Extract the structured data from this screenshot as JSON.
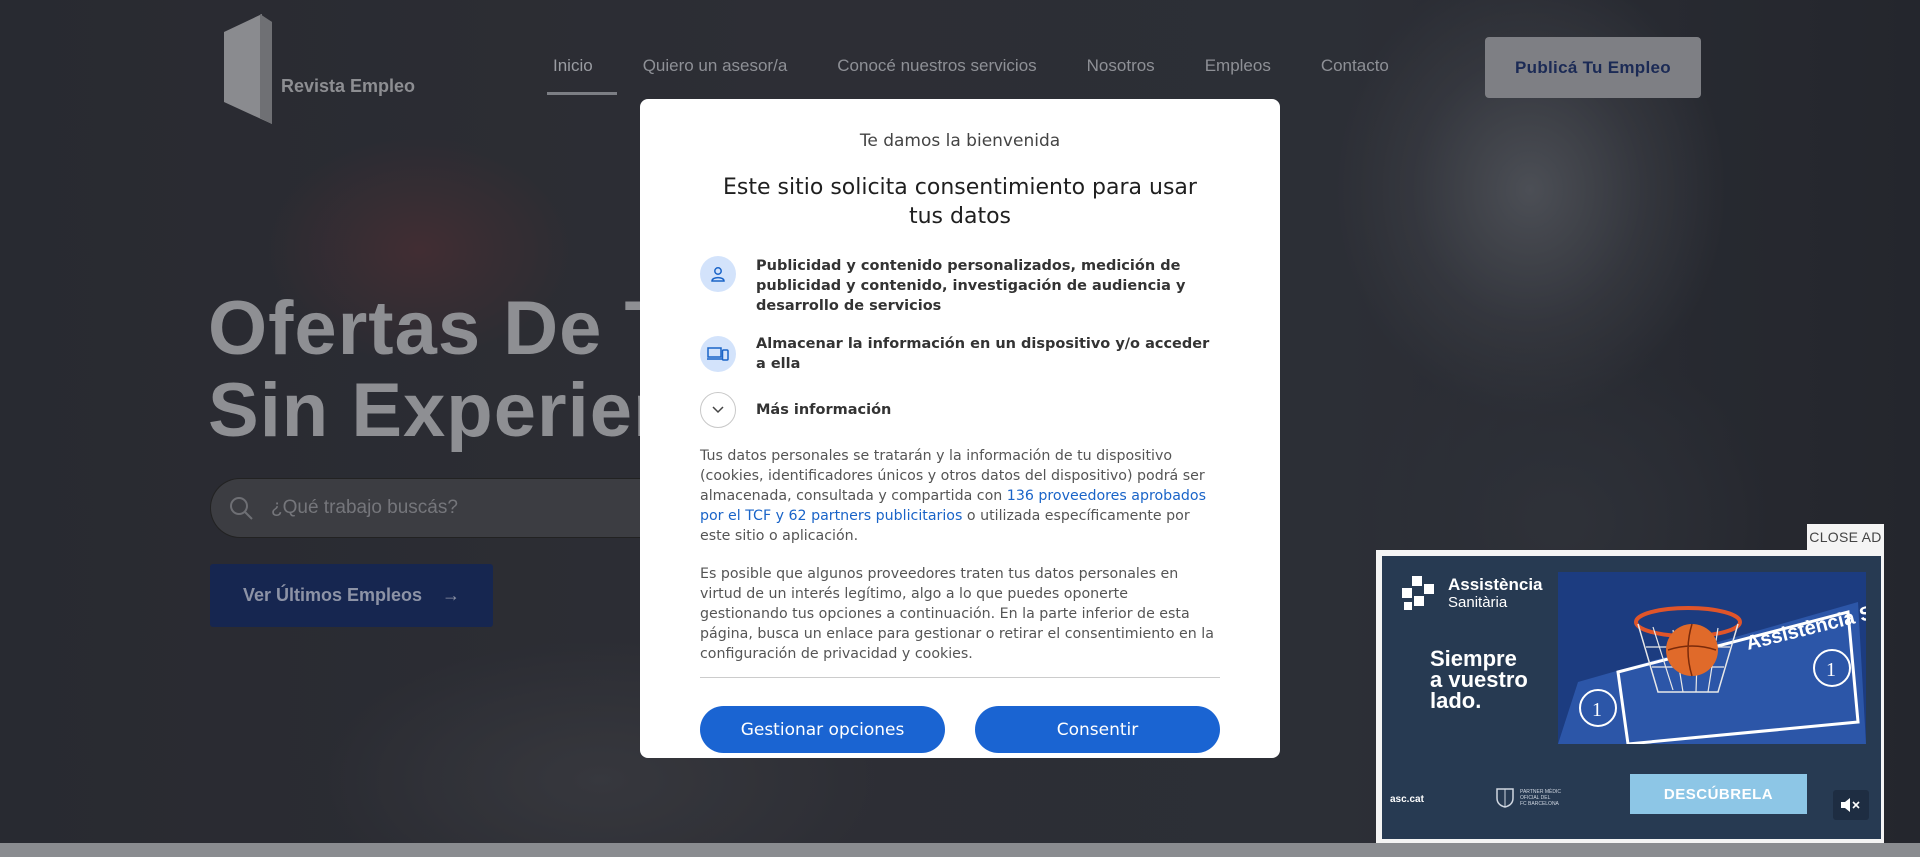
{
  "header": {
    "logo_text": "Revista Empleo",
    "nav": [
      {
        "label": "Inicio",
        "active": true
      },
      {
        "label": "Quiero un asesor/a",
        "active": false
      },
      {
        "label": "Conocé nuestros servicios",
        "active": false
      },
      {
        "label": "Nosotros",
        "active": false
      },
      {
        "label": "Empleos",
        "active": false
      },
      {
        "label": "Contacto",
        "active": false
      }
    ],
    "cta_label": "Publicá Tu Empleo"
  },
  "hero": {
    "headline_line1": "Ofertas De T",
    "headline_line2": "Sin Experien",
    "search_placeholder": "¿Qué trabajo buscás?",
    "jobs_button_label": "Ver Últimos Empleos",
    "jobs_button_arrow": "→"
  },
  "consent": {
    "welcome": "Te damos la bienvenida",
    "title": "Este sitio solicita consentimiento para usar tus datos",
    "purposes": [
      {
        "icon": "person-icon",
        "text": "Publicidad y contenido personalizados, medición de publicidad y contenido, investigación de audiencia y desarrollo de servicios"
      },
      {
        "icon": "devices-icon",
        "text": "Almacenar la información en un dispositivo y/o acceder a ella"
      }
    ],
    "more_info": "Más información",
    "paragraph1_before": "Tus datos personales se tratarán y la información de tu dispositivo (cookies, identificadores únicos y otros datos del dispositivo) podrá ser almacenada, consultada y compartida con ",
    "paragraph1_link": "136 proveedores aprobados por el TCF y 62 partners publicitarios",
    "paragraph1_after": " o utilizada específicamente por este sitio o aplicación.",
    "paragraph2": "Es posible que algunos proveedores traten tus datos personales en virtud de un interés legítimo, algo a lo que puedes oponerte gestionando tus opciones a continuación. En la parte inferior de esta página, busca un enlace para gestionar o retirar el consentimiento en la configuración de privacidad y cookies.",
    "manage_label": "Gestionar opciones",
    "consent_label": "Consentir",
    "accent_color": "#1a64d2"
  },
  "ad": {
    "close_label": "CLOSE AD",
    "brand_line1": "Assistència",
    "brand_line2": "Sanitària",
    "slogan_line1": "Siempre",
    "slogan_line2": "a vuestro",
    "slogan_line3": "lado.",
    "photo_text": "Assistència Sanitària",
    "domain": "asc.cat",
    "partner_line1": "PARTNER MÈDIC",
    "partner_line2": "OFICIAL DEL",
    "partner_line3": "FC BARCELONA",
    "cta_label": "DESCÚBRELA",
    "mute_icon": "speaker-muted-icon"
  }
}
